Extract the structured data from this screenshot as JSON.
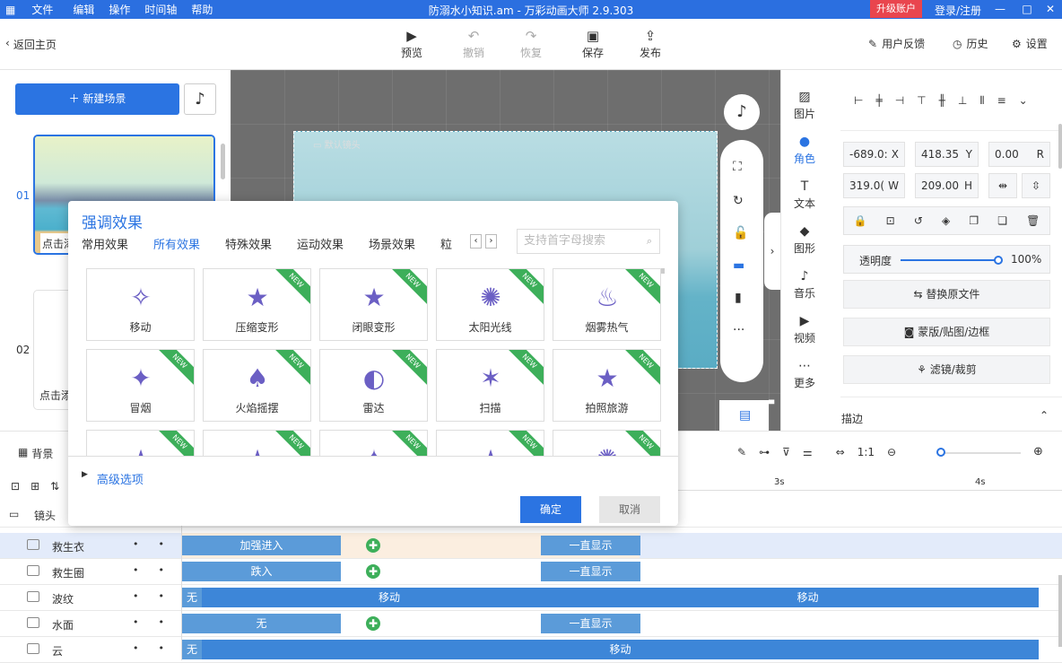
{
  "menu": [
    "文件",
    "编辑",
    "操作",
    "时间轴",
    "帮助"
  ],
  "window_title": "防溺水小知识.am - 万彩动画大师 2.9.303",
  "upgrade": "升级账户",
  "login": "登录/注册",
  "toolbar": {
    "back": "返回主页",
    "preview": "预览",
    "undo": "撤销",
    "redo": "恢复",
    "save": "保存",
    "publish": "发布",
    "feedback": "用户反馈",
    "history": "历史",
    "settings": "设置"
  },
  "left": {
    "new_scene": "新建场景",
    "scene1_num": "01",
    "scene1_text": "点击添",
    "scene2_num": "02",
    "scene2_text": "点击添"
  },
  "canvas": {
    "camera_label": "默认镜头"
  },
  "rightnav": [
    "图片",
    "角色",
    "文本",
    "图形",
    "音乐",
    "视频",
    "更多"
  ],
  "props": {
    "x": "-689.0:",
    "x_u": "X",
    "y": "418.35",
    "y_u": "Y",
    "r": "0.00",
    "r_u": "R",
    "w": "319.0(",
    "w_u": "W",
    "h": "209.00",
    "h_u": "H",
    "opacity_label": "透明度",
    "opacity_value": "100%",
    "opacity": 1.0,
    "replace": "替换原文件",
    "mask": "蒙版/贴图/边框",
    "filter": "滤镜/裁剪",
    "stroke": "描边"
  },
  "dialog": {
    "title": "强调效果",
    "tabs": [
      "常用效果",
      "所有效果",
      "特殊效果",
      "运动效果",
      "场景效果",
      "粒"
    ],
    "search_placeholder": "支持首字母搜索",
    "new_badge": "NEW",
    "cards": [
      {
        "name": "移动",
        "new": false
      },
      {
        "name": "压缩变形",
        "new": true
      },
      {
        "name": "闭眼变形",
        "new": true
      },
      {
        "name": "太阳光线",
        "new": true
      },
      {
        "name": "烟雾热气",
        "new": true
      },
      {
        "name": "冒烟",
        "new": true
      },
      {
        "name": "火焰摇摆",
        "new": true
      },
      {
        "name": "雷达",
        "new": true
      },
      {
        "name": "扫描",
        "new": true
      },
      {
        "name": "拍照旅游",
        "new": true
      },
      {
        "name": "",
        "new": true
      },
      {
        "name": "",
        "new": true
      },
      {
        "name": "",
        "new": true
      },
      {
        "name": "",
        "new": true
      },
      {
        "name": "",
        "new": true
      }
    ],
    "advanced": "高级选项",
    "ok": "确定",
    "cancel": "取消"
  },
  "timeline": {
    "bg_label": "背景",
    "camera": "镜头",
    "ticks": [
      "3s",
      "4s"
    ],
    "rows": [
      {
        "name": "救生衣",
        "bars": [
          {
            "t": "加强进入"
          },
          {
            "t": "一直显示"
          }
        ]
      },
      {
        "name": "救生圈",
        "bars": [
          {
            "t": "跌入"
          },
          {
            "t": "一直显示"
          }
        ]
      },
      {
        "name": "波纹",
        "bars": [
          {
            "t": "无"
          },
          {
            "t": "移动"
          },
          {
            "t": "移动"
          }
        ]
      },
      {
        "name": "水面",
        "bars": [
          {
            "t": "无"
          },
          {
            "t": "一直显示"
          }
        ]
      },
      {
        "name": "云",
        "bars": [
          {
            "t": "无"
          },
          {
            "t": "移动"
          }
        ]
      }
    ]
  }
}
